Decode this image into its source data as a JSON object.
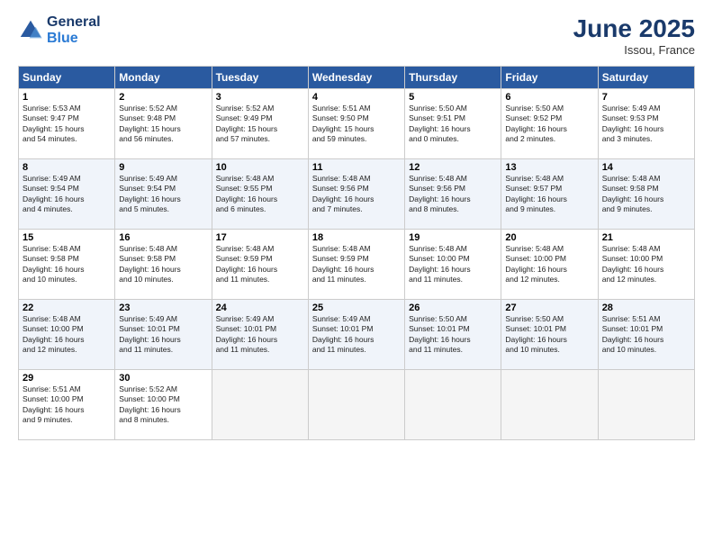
{
  "header": {
    "logo_line1": "General",
    "logo_line2": "Blue",
    "month": "June 2025",
    "location": "Issou, France"
  },
  "days_of_week": [
    "Sunday",
    "Monday",
    "Tuesday",
    "Wednesday",
    "Thursday",
    "Friday",
    "Saturday"
  ],
  "weeks": [
    [
      {
        "day": "1",
        "info": "Sunrise: 5:53 AM\nSunset: 9:47 PM\nDaylight: 15 hours\nand 54 minutes."
      },
      {
        "day": "2",
        "info": "Sunrise: 5:52 AM\nSunset: 9:48 PM\nDaylight: 15 hours\nand 56 minutes."
      },
      {
        "day": "3",
        "info": "Sunrise: 5:52 AM\nSunset: 9:49 PM\nDaylight: 15 hours\nand 57 minutes."
      },
      {
        "day": "4",
        "info": "Sunrise: 5:51 AM\nSunset: 9:50 PM\nDaylight: 15 hours\nand 59 minutes."
      },
      {
        "day": "5",
        "info": "Sunrise: 5:50 AM\nSunset: 9:51 PM\nDaylight: 16 hours\nand 0 minutes."
      },
      {
        "day": "6",
        "info": "Sunrise: 5:50 AM\nSunset: 9:52 PM\nDaylight: 16 hours\nand 2 minutes."
      },
      {
        "day": "7",
        "info": "Sunrise: 5:49 AM\nSunset: 9:53 PM\nDaylight: 16 hours\nand 3 minutes."
      }
    ],
    [
      {
        "day": "8",
        "info": "Sunrise: 5:49 AM\nSunset: 9:54 PM\nDaylight: 16 hours\nand 4 minutes."
      },
      {
        "day": "9",
        "info": "Sunrise: 5:49 AM\nSunset: 9:54 PM\nDaylight: 16 hours\nand 5 minutes."
      },
      {
        "day": "10",
        "info": "Sunrise: 5:48 AM\nSunset: 9:55 PM\nDaylight: 16 hours\nand 6 minutes."
      },
      {
        "day": "11",
        "info": "Sunrise: 5:48 AM\nSunset: 9:56 PM\nDaylight: 16 hours\nand 7 minutes."
      },
      {
        "day": "12",
        "info": "Sunrise: 5:48 AM\nSunset: 9:56 PM\nDaylight: 16 hours\nand 8 minutes."
      },
      {
        "day": "13",
        "info": "Sunrise: 5:48 AM\nSunset: 9:57 PM\nDaylight: 16 hours\nand 9 minutes."
      },
      {
        "day": "14",
        "info": "Sunrise: 5:48 AM\nSunset: 9:58 PM\nDaylight: 16 hours\nand 9 minutes."
      }
    ],
    [
      {
        "day": "15",
        "info": "Sunrise: 5:48 AM\nSunset: 9:58 PM\nDaylight: 16 hours\nand 10 minutes."
      },
      {
        "day": "16",
        "info": "Sunrise: 5:48 AM\nSunset: 9:58 PM\nDaylight: 16 hours\nand 10 minutes."
      },
      {
        "day": "17",
        "info": "Sunrise: 5:48 AM\nSunset: 9:59 PM\nDaylight: 16 hours\nand 11 minutes."
      },
      {
        "day": "18",
        "info": "Sunrise: 5:48 AM\nSunset: 9:59 PM\nDaylight: 16 hours\nand 11 minutes."
      },
      {
        "day": "19",
        "info": "Sunrise: 5:48 AM\nSunset: 10:00 PM\nDaylight: 16 hours\nand 11 minutes."
      },
      {
        "day": "20",
        "info": "Sunrise: 5:48 AM\nSunset: 10:00 PM\nDaylight: 16 hours\nand 12 minutes."
      },
      {
        "day": "21",
        "info": "Sunrise: 5:48 AM\nSunset: 10:00 PM\nDaylight: 16 hours\nand 12 minutes."
      }
    ],
    [
      {
        "day": "22",
        "info": "Sunrise: 5:48 AM\nSunset: 10:00 PM\nDaylight: 16 hours\nand 12 minutes."
      },
      {
        "day": "23",
        "info": "Sunrise: 5:49 AM\nSunset: 10:01 PM\nDaylight: 16 hours\nand 11 minutes."
      },
      {
        "day": "24",
        "info": "Sunrise: 5:49 AM\nSunset: 10:01 PM\nDaylight: 16 hours\nand 11 minutes."
      },
      {
        "day": "25",
        "info": "Sunrise: 5:49 AM\nSunset: 10:01 PM\nDaylight: 16 hours\nand 11 minutes."
      },
      {
        "day": "26",
        "info": "Sunrise: 5:50 AM\nSunset: 10:01 PM\nDaylight: 16 hours\nand 11 minutes."
      },
      {
        "day": "27",
        "info": "Sunrise: 5:50 AM\nSunset: 10:01 PM\nDaylight: 16 hours\nand 10 minutes."
      },
      {
        "day": "28",
        "info": "Sunrise: 5:51 AM\nSunset: 10:01 PM\nDaylight: 16 hours\nand 10 minutes."
      }
    ],
    [
      {
        "day": "29",
        "info": "Sunrise: 5:51 AM\nSunset: 10:00 PM\nDaylight: 16 hours\nand 9 minutes."
      },
      {
        "day": "30",
        "info": "Sunrise: 5:52 AM\nSunset: 10:00 PM\nDaylight: 16 hours\nand 8 minutes."
      },
      null,
      null,
      null,
      null,
      null
    ]
  ]
}
